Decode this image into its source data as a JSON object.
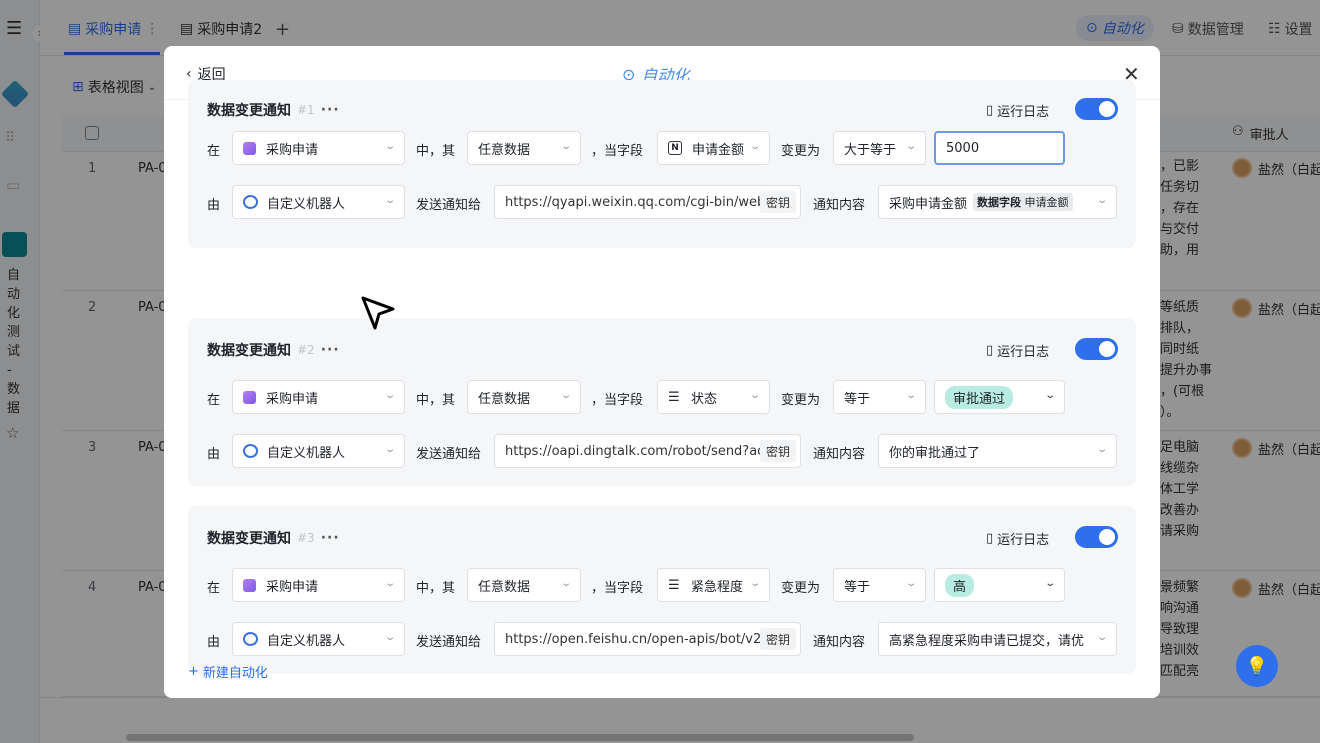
{
  "tabs": [
    {
      "label": "采购申请"
    },
    {
      "label": "采购申请2"
    }
  ],
  "topright": {
    "automation": "自动化",
    "data_mgmt": "数据管理",
    "settings": "设置"
  },
  "view": {
    "label": "表格视图"
  },
  "sidebar": {
    "app_name_chars": [
      "自",
      "动",
      "化",
      "测",
      "试",
      "-",
      "数",
      "据"
    ]
  },
  "grid": {
    "approver_header": "审批人",
    "rows": [
      {
        "num": "1",
        "pa": "PA-0",
        "desc": [
          "，已影",
          "任务切",
          "，存在",
          "与交付",
          "助，用"
        ],
        "approver": "盐然（白起"
      },
      {
        "num": "2",
        "pa": "PA-0",
        "desc": [
          "等纸质",
          "排队，",
          "同时纸",
          "提升办事",
          "，(可根",
          "）。"
        ],
        "approver": "盐然（白起"
      },
      {
        "num": "3",
        "pa": "PA-0",
        "desc": [
          "足电脑",
          "线缆杂",
          "体工学",
          "改善办",
          "请采购"
        ],
        "approver": "盐然（白起"
      },
      {
        "num": "4",
        "pa": "PA-0",
        "desc": [
          "景频繁",
          "响沟通",
          "导致理",
          "培训效",
          "匹配亮"
        ],
        "approver": "盐然（白起"
      }
    ]
  },
  "modal": {
    "back": "返回",
    "title": "自动化",
    "new_automation": "新建自动化",
    "cards": [
      {
        "title": "数据变更通知",
        "num": "#1",
        "run_log": "运行日志",
        "enabled": true,
        "in_label": "在",
        "table": "采购申请",
        "of_label": "中，其",
        "scope": "任意数据",
        "when_label": "，当字段",
        "field": "申请金额",
        "changed_label": "变更为",
        "op": "大于等于",
        "value": "5000",
        "by_label": "由",
        "sender": "自定义机器人",
        "send_to_label": "发送通知给",
        "url": "https://qyapi.weixin.qq.com/cgi-bin/web",
        "secret": "密钥",
        "content_label": "通知内容",
        "content": "采购申请金额",
        "content_chip_a": "数据字段",
        "content_chip_b": "申请金额"
      },
      {
        "title": "数据变更通知",
        "num": "#2",
        "run_log": "运行日志",
        "enabled": true,
        "in_label": "在",
        "table": "采购申请",
        "of_label": "中，其",
        "scope": "任意数据",
        "when_label": "，当字段",
        "field": "状态",
        "changed_label": "变更为",
        "op": "等于",
        "value": "审批通过",
        "by_label": "由",
        "sender": "自定义机器人",
        "send_to_label": "发送通知给",
        "url": "https://oapi.dingtalk.com/robot/send?ac",
        "secret": "密钥",
        "content_label": "通知内容",
        "content": "你的审批通过了"
      },
      {
        "title": "数据变更通知",
        "num": "#3",
        "run_log": "运行日志",
        "enabled": true,
        "in_label": "在",
        "table": "采购申请",
        "of_label": "中，其",
        "scope": "任意数据",
        "when_label": "，当字段",
        "field": "紧急程度",
        "changed_label": "变更为",
        "op": "等于",
        "value": "高",
        "by_label": "由",
        "sender": "自定义机器人",
        "send_to_label": "发送通知给",
        "url": "https://open.feishu.cn/open-apis/bot/v2/",
        "secret": "密钥",
        "content_label": "通知内容",
        "content": "高紧急程度采购申请已提交，请优"
      }
    ]
  },
  "colors": {
    "accent": "#2f6fec",
    "pill": "#b8ebe1",
    "title": "#4a8af4"
  }
}
